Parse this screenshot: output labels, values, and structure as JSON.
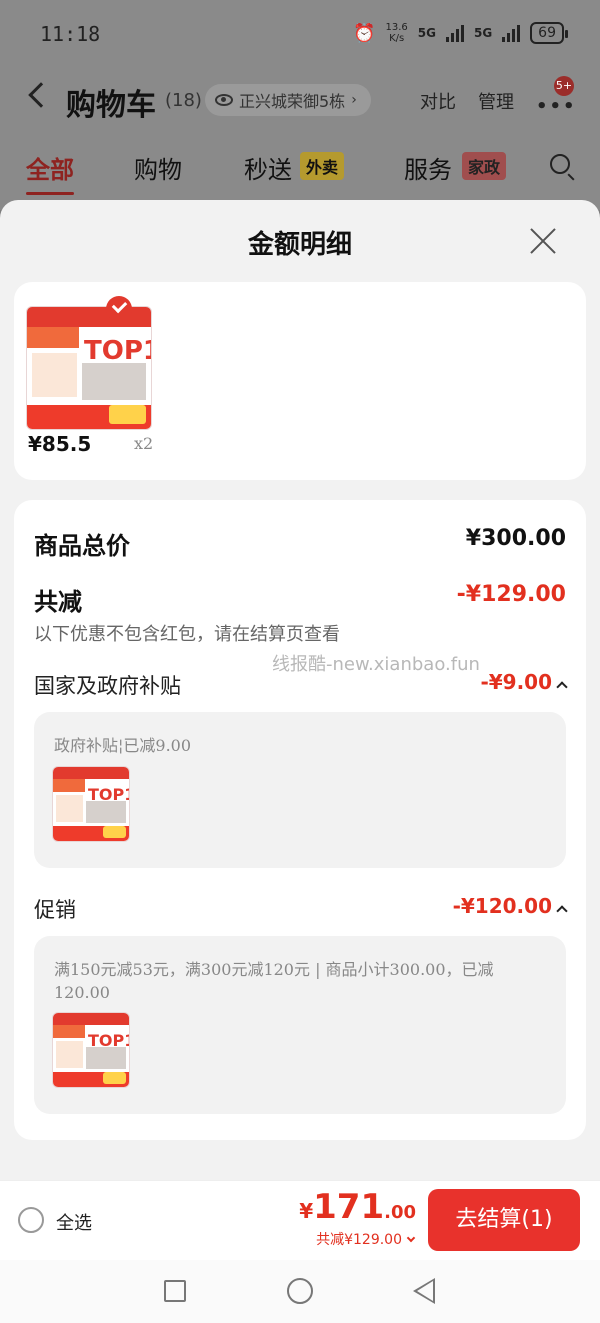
{
  "status": {
    "time": "11:18",
    "speed_value": "13.6",
    "speed_unit": "K/s",
    "network1": "5G",
    "network2": "5G",
    "battery": "69"
  },
  "header": {
    "title": "购物车",
    "count": "(18)",
    "address": "正兴城荣御5栋",
    "compare": "对比",
    "manage": "管理",
    "more_badge": "5+"
  },
  "tabs": {
    "all": "全部",
    "shopping": "购物",
    "express": "秒送",
    "express_tag": "外卖",
    "service": "服务",
    "service_tag": "家政"
  },
  "sheet": {
    "title": "金额明细",
    "product": {
      "price": "¥85.5",
      "qty": "x2",
      "thumb_text": "TOP1"
    },
    "total_label": "商品总价",
    "total_value": "¥300.00",
    "discount_label": "共减",
    "discount_value": "-¥129.00",
    "note": "以下优惠不包含红包，请在结算页查看",
    "watermark": "线报酷-new.xianbao.fun",
    "subsidy_label": "国家及政府补贴",
    "subsidy_value": "-¥9.00",
    "subsidy_desc": "政府补贴¦已减9.00",
    "promo_label": "促销",
    "promo_value": "-¥120.00",
    "promo_desc": "满150元减53元，满300元减120元 | 商品小计300.00，已减120.00"
  },
  "bottom": {
    "select_all": "全选",
    "yen": "¥",
    "total_int": "171",
    "total_dec": ".00",
    "saved": "共减¥129.00",
    "checkout": "去结算(1)"
  }
}
